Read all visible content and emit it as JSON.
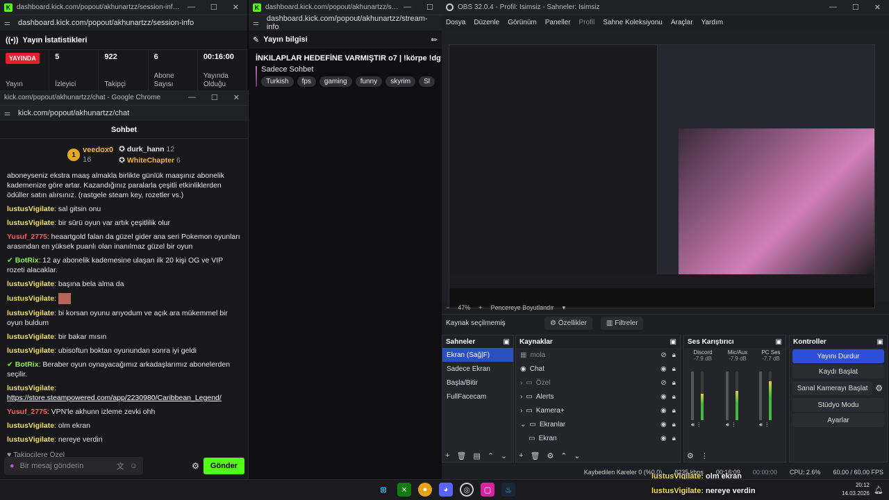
{
  "session_window": {
    "title": "dashboard.kick.com/popout/akhunartzz/session-info - Google Chro...",
    "url": "dashboard.kick.com/popout/akhunartzz/session-info",
    "section": "Yayın İstatistikleri",
    "live_badge": "YAYINDA",
    "live_label": "Yayın",
    "stats": [
      {
        "value": "5",
        "label": "İzleyici"
      },
      {
        "value": "922",
        "label": "Takipçi"
      },
      {
        "value": "6",
        "label": "Abone Sayısı"
      },
      {
        "value": "00:16:00",
        "label": "Yayında Olduğu"
      }
    ]
  },
  "chat_window": {
    "title": "kick.com/popout/akhunartzz/chat - Google Chrome",
    "url": "kick.com/popout/akhunartzz/chat",
    "heading": "Sohbet",
    "leaderboard": [
      {
        "rank": "1",
        "name": "veedox0",
        "count": "16"
      },
      {
        "name": "durk_hann",
        "count": "12"
      },
      {
        "name": "WhiteChapter",
        "count": "6"
      }
    ],
    "intro": "aboneyseniz ekstra maaş almakla birlikte günlük maaşınız abonelik kademenize göre artar. Kazandığınız paralarla çeşitli etkinliklerden ödüller satın alırsınız. (rastgele steam key, rozetler vs.)",
    "messages": [
      {
        "user": "lustusVigilate",
        "color": "yellow",
        "text": "sal gitsin onu"
      },
      {
        "user": "lustusVigilate",
        "color": "yellow",
        "text": "bir sürü oyun var artık çeşitlilik olur"
      },
      {
        "user": "Yusuf_2775",
        "color": "red",
        "text": "heaartgold falan da güzel gider ana seri Pokemon oyunları arasından en yüksek puanlı olan inanılmaz güzel bir oyun"
      },
      {
        "user": "BotRix",
        "color": "green",
        "text": "12 ay abonelik kademesine ulaşan ilk 20 kişi OG ve VIP rozeti alacaklar."
      },
      {
        "user": "lustusVigilate",
        "color": "yellow",
        "text": "başına bela alma da"
      },
      {
        "user": "lustusVigilate",
        "color": "yellow",
        "text": ""
      },
      {
        "user": "lustusVigilate",
        "color": "yellow",
        "text": "bi korsan oyunu arıyodum ve açık ara mükemmel bir oyun buldum"
      },
      {
        "user": "lustusVigilate",
        "color": "yellow",
        "text": "bir bakar mısın"
      },
      {
        "user": "lustusVigilate",
        "color": "yellow",
        "text": "ubisoftun boktan oyunundan sonra iyi geldi"
      },
      {
        "user": "BotRix",
        "color": "green",
        "text": "Beraber oyun oynayacağımız arkadaşlarımız abonelerden seçilir."
      },
      {
        "user": "lustusVigilate",
        "color": "yellow",
        "text": "https://store.steampowered.com/app/2230980/Caribbean_Legend/"
      },
      {
        "user": "Yusuf_2775",
        "color": "red",
        "text": "VPN'le akhunn izleme zevki ohh"
      },
      {
        "user": "lustusVigilate",
        "color": "yellow",
        "text": "olm ekran"
      },
      {
        "user": "lustusVigilate",
        "color": "yellow",
        "text": "nereye verdin"
      }
    ],
    "follower_emotes_label": "Takipçilere Özel",
    "input_placeholder": "Bir mesaj gönderin",
    "send": "Gönder"
  },
  "stream_window": {
    "title": "dashboard.kick.com/popout/akhunartzz/strea...",
    "url": "dashboard.kick.com/popout/akhunartzz/stream-info",
    "section": "Yayın bilgisi",
    "stream_title": "İNKILAPLAR HEDEFİNE VARMIŞTIR o7 | !körpe !dg",
    "category": "Sadece Sohbet",
    "tags": [
      "Turkish",
      "fps",
      "gaming",
      "funny",
      "skyrim",
      "Sl"
    ]
  },
  "obs": {
    "title": "OBS 32.0.4 - Profil: İsimsiz - Sahneler: İsimsiz",
    "menu": [
      "Dosya",
      "Düzenle",
      "Görünüm",
      "Paneller",
      "Profil",
      "Sahne Koleksiyonu",
      "Araçlar",
      "Yardım"
    ],
    "zoom": "47%",
    "fit": "Pencereye Boyutlandır",
    "context_label": "Kaynak seçilmemiş",
    "props_btn": "Özellikler",
    "filters_btn": "Filtreler",
    "scenes_title": "Sahneler",
    "scenes": [
      "Ekran (Sağ|F)",
      "Sadece Ekran",
      "Başla/Bitir",
      "FullFacecam"
    ],
    "sources_title": "Kaynaklar",
    "sources": [
      "mola",
      "Chat",
      "Özel",
      "Alerts",
      "Kamera+",
      "Ekranlar",
      "Ekran"
    ],
    "mixer_title": "Ses Karıştırıcı",
    "mixer": [
      {
        "name": "Discord",
        "db": "-7.9 dB",
        "level": 0.55
      },
      {
        "name": "Mic/Aux",
        "db": "-7.9 dB",
        "level": 0.6
      },
      {
        "name": "PC Ses",
        "db": "-7.7 dB",
        "level": 0.8
      }
    ],
    "controls_title": "Kontroller",
    "controls": [
      "Yayını Durdur",
      "Kaydı Başlat",
      "Sanal Kamerayı Başlat",
      "Stüdyo Modu",
      "Ayarlar"
    ],
    "status": {
      "dropped": "Kaybedilen Kareler 0 (%0.0)",
      "kbps": "8235 kbps",
      "live_time": "00:16:09",
      "rec_time": "00:00:00",
      "cpu": "CPU: 2.6%",
      "fps": "60.00 / 60.00 FPS"
    }
  },
  "overlay_lines": [
    {
      "user": "lustusVigilate:",
      "text": "olm ekran"
    },
    {
      "user": "lustusVigilate:",
      "text": "nereye verdin"
    }
  ],
  "taskbar": {
    "time": "20:12",
    "date": "14.03.2026"
  },
  "colors": {
    "kick_green": "#53fc18",
    "live_red": "#e5202e",
    "obs_blue": "#2e4ed8"
  }
}
